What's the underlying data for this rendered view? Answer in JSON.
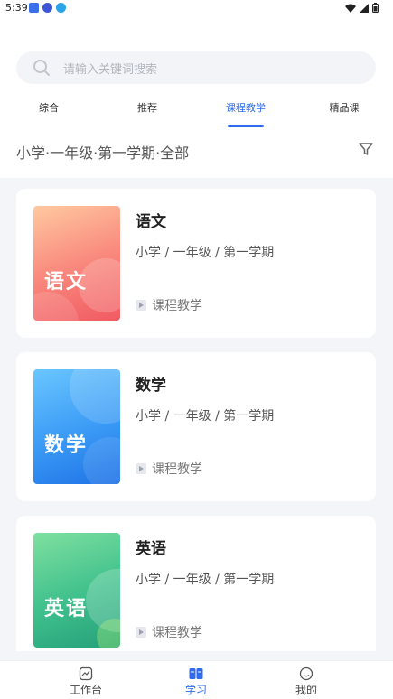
{
  "status_bar": {
    "time": "5:39"
  },
  "search": {
    "placeholder": "请输入关键词搜索",
    "icon": "search-icon"
  },
  "tabs": [
    {
      "label": "综合",
      "active": false
    },
    {
      "label": "推荐",
      "active": false
    },
    {
      "label": "课程教学",
      "active": true
    },
    {
      "label": "精品课",
      "active": false
    }
  ],
  "filter": {
    "text": "小学·一年级·第一学期·全部",
    "icon": "filter-icon"
  },
  "courses": [
    {
      "title": "语文",
      "subtitle": "小学 / 一年级 / 第一学期",
      "tag": "课程教学",
      "cover_label": "语文",
      "cover_color": "#f36b6b"
    },
    {
      "title": "数学",
      "subtitle": "小学 / 一年级 / 第一学期",
      "tag": "课程教学",
      "cover_label": "数学",
      "cover_color": "#2f8cf0"
    },
    {
      "title": "英语",
      "subtitle": "小学 / 一年级 / 第一学期",
      "tag": "课程教学",
      "cover_label": "英语",
      "cover_color": "#34b98a"
    }
  ],
  "bottom_nav": [
    {
      "label": "工作台",
      "icon": "workbench-icon",
      "active": false
    },
    {
      "label": "学习",
      "icon": "book-icon",
      "active": true
    },
    {
      "label": "我的",
      "icon": "profile-icon",
      "active": false
    }
  ],
  "colors": {
    "accent": "#2f6bea"
  }
}
